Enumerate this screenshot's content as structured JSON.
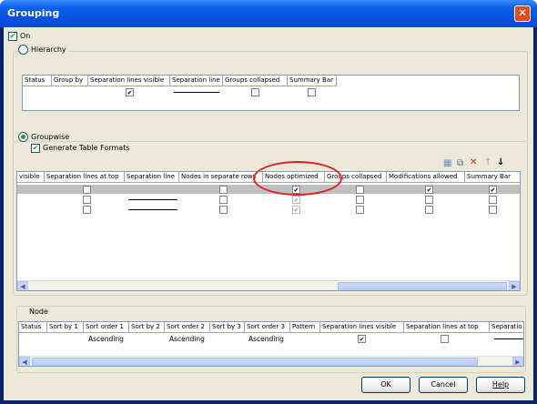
{
  "window": {
    "title": "Grouping",
    "close": "✕"
  },
  "on_checkbox": {
    "label": "On",
    "checked": true
  },
  "hierarchy": {
    "radio_label": "Hierarchy",
    "columns": [
      "Status",
      "Group by",
      "Separation lines visible",
      "Separation line",
      "Groups collapsed",
      "Summary Bar"
    ]
  },
  "groupwise": {
    "radio_label": "Groupwise",
    "generate_label": "Generate Table Formats",
    "columns": [
      "visible",
      "Separation lines at top",
      "Separation line",
      "Nodes in separate rows",
      "Nodes optimized",
      "Groups collapsed",
      "Modifications allowed",
      "Summary Bar"
    ],
    "rows": [
      {
        "lines_at_top": false,
        "separate_rows": false,
        "optimized": true,
        "collapsed": false,
        "mods": true,
        "summary": true
      },
      {
        "lines_at_top": false,
        "separate_rows": false,
        "optimized": true,
        "collapsed": false,
        "mods": false,
        "summary": false
      },
      {
        "lines_at_top": false,
        "separate_rows": false,
        "optimized": true,
        "collapsed": false,
        "mods": false,
        "summary": false
      }
    ],
    "toolbar_icons": [
      "new-row-icon",
      "copy-icon",
      "delete-icon",
      "move-up-icon",
      "move-down-icon"
    ]
  },
  "node": {
    "title": "Node",
    "columns": [
      "Status",
      "Sort by 1",
      "Sort order 1",
      "Sort by 2",
      "Sort order 2",
      "Sort by 3",
      "Sort order 3",
      "Pattern",
      "Separation lines visible",
      "Separation lines at top",
      "Separatio"
    ],
    "row": {
      "sort_order_1": "Ascending",
      "sort_order_2": "Ascending",
      "sort_order_3": "Ascending"
    }
  },
  "buttons": {
    "ok": "OK",
    "cancel": "Cancel",
    "help": "Help"
  },
  "colors": {
    "title_bar": "#0553e0",
    "dialog_bg": "#ece9d8",
    "highlight_ellipse": "#e02020",
    "check_green": "#21a121"
  }
}
